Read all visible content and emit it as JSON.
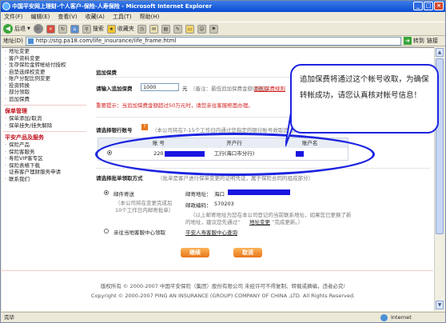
{
  "window": {
    "title": "中国平安网上理财-个人客户-保险-人寿保险 - Microsoft Internet Explorer",
    "controls": [
      "_",
      "□",
      "×"
    ]
  },
  "menubar": [
    "文件(F)",
    "编辑(E)",
    "查看(V)",
    "收藏(A)",
    "工具(T)",
    "帮助(H)"
  ],
  "toolbar": {
    "back": "后退",
    "search": "搜索",
    "favorites": "收藏夹"
  },
  "addressbar": {
    "label": "地址(D)",
    "url": "http://stg.pa18.com/life_insurance/life_frame.html",
    "go": "转到",
    "links": "链接"
  },
  "leftnav": {
    "items1": [
      "地址变更",
      "客户资料变更",
      "生存保险金转帐给付授权",
      "自垫选择权变更",
      "账户分配比例变更",
      "投资转换",
      "部分领取",
      "追加保费"
    ],
    "group2_title": "保单管理",
    "items2": [
      "保单添加/取消",
      "保单挂失/挂失解除"
    ],
    "group3_title": "平安产品及服务",
    "items3": [
      "保险产品",
      "保险客服务",
      "寿险VIP客专区",
      "保险表格下载",
      "证券客户理财服务申请",
      "联系我们"
    ]
  },
  "main": {
    "section_title": "追加保费",
    "amount_label": "请输入追加保费",
    "amount_value": "1000",
    "amount_unit": "元",
    "amount_hint": "（备注：最低追加保费金额请参见",
    "amount_link": "追加保费规则",
    "warning": "重要提示：当追加保费金额超过50万元时，请您亲往客服柜面办理。",
    "bank_label": "请选择银行账号",
    "bank_note": "（本公司将在7-15个工作日内通过您指定的银行账号收取追加保费）",
    "table_headers": [
      "账 号",
      "开户行",
      "账户名"
    ],
    "table_row": {
      "account_prefix": "220",
      "bank": "工行(海口市分行)"
    },
    "delivery_label": "请选择批单领取方式",
    "delivery_note": "（批单是客户进行保单变更的证明凭证，属于保险合同的组成部分）",
    "mail_option": "邮件寄送",
    "mail_detail1": "（本公司将在变更完成后",
    "mail_detail2": "10个工作日内邮寄批单）",
    "mail_address_label": "邮寄地址：",
    "mail_address_value": "海口",
    "mail_zip_label": "邮政编码：",
    "mail_zip_value": "570203",
    "mail_tip1": "（以上邮寄地址为您在本公司登记的当前联系地址，如果您已更换了新",
    "mail_tip2": "的地址，建议您先通过“",
    "mail_tip_link": "地址变更",
    "mail_tip3": "”完成更新。）",
    "counter_option": "亲往当地客服中心领取",
    "counter_link": "平安人寿客服中心查询",
    "continue": "继续",
    "cancel": "取消"
  },
  "footer": {
    "cn": "版权所有 © 2000-2007 中国平安保险（集团）股份有限公司 未经许可不得复制、转载或摘编，违者必究!",
    "en": "Copyright © 2000-2007 PING AN INSURANCE (GROUP) COMPANY OF CHINA ,LTD. All Rights Reserved."
  },
  "statusbar": {
    "left": "完毕",
    "zone": "Internet"
  },
  "callout": {
    "text": "追加保费将通过这个帐号收取，为确保转帐成功，请您认真核对帐号信息！"
  },
  "colors": {
    "accent_red": "#d31e1e",
    "callout_blue": "#1c24e0",
    "button_orange": "#e8761a"
  }
}
